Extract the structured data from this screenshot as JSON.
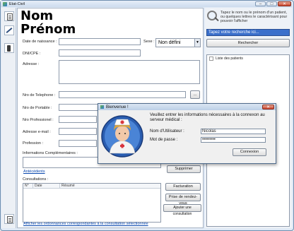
{
  "window": {
    "title": "Etat-Civil",
    "controls": {
      "minimize": "–",
      "maximize": "□",
      "close": "✕"
    }
  },
  "toolbar": {
    "tools": [
      {
        "icon": "document-icon"
      },
      {
        "icon": "pen-icon"
      },
      {
        "icon": "stand-icon"
      }
    ]
  },
  "patient": {
    "nom": "Nom",
    "prenom": "Prénom"
  },
  "form": {
    "date_naissance_label": "Date de naissance :",
    "sexe_label": "Sexe :",
    "sexe_value": "Non défini",
    "dni_label": "DNI/CPE :",
    "adresse_label": "Adresse :",
    "tel_label": "Nro de Telephone :",
    "portable_label": "Nro de Portable :",
    "pro_label": "Nro Professionel :",
    "email_label": "Adresse e-mail :",
    "profession_label": "Profession :",
    "info_label": "Informations Complémentaires :",
    "email_button": "...",
    "suppr_button": "Supprimer"
  },
  "links": {
    "antecedents": "Antécédents",
    "afficher": "Afficher les ordonnances correspondantes à la consultation sélectionnée"
  },
  "consultations": {
    "title": "Consultations :",
    "columns": [
      "N°",
      "Date",
      "Résumé"
    ],
    "facturation": "Facturation",
    "prise_rdv": "Prise de rendez-vous",
    "ajouter": "Ajouter une consultation"
  },
  "search": {
    "help": "Tapez le nom ou le prénom d'un patient, ou quelques lettres le caractérisant pour pouvoir l'afficher",
    "placeholder": "Tapez votre recherche ici...",
    "button": "Rechercher",
    "list_title": "Liste des patients"
  },
  "dialog": {
    "title": "Bienvenue !",
    "close": "✕",
    "message": "Veuillez entrer les informations nécessaires à la connexon au serveur médical :",
    "user_label": "Nom d'Utilisateur :",
    "user_value": "Nicolas",
    "pass_label": "Mot de passe :",
    "pass_value": "•••••••••",
    "connect": "Connexion"
  }
}
